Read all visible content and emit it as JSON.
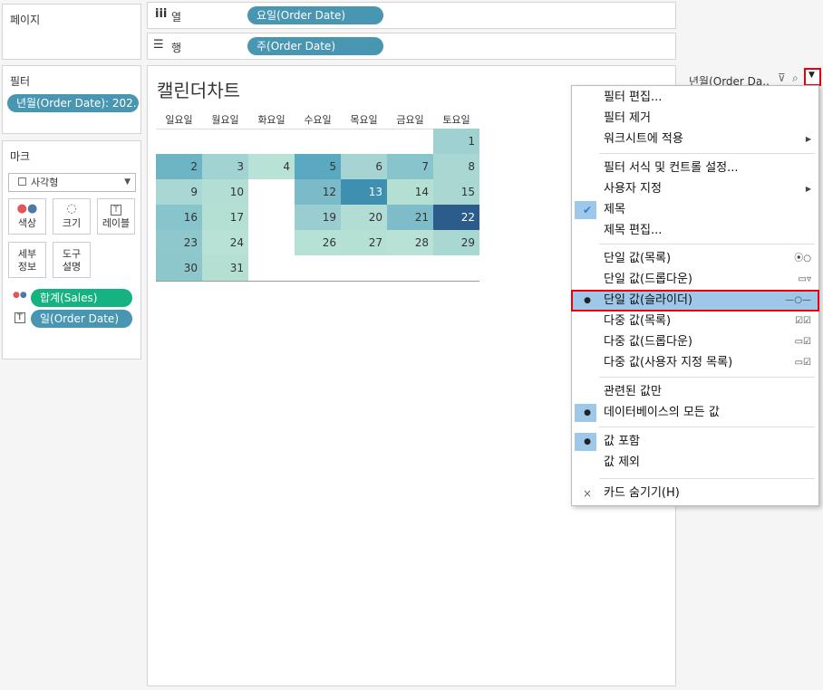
{
  "left": {
    "pages_title": "페이지",
    "filters_title": "필터",
    "filter_pill": "년월(Order Date): 202..",
    "marks_title": "마크",
    "mark_type": "사각형",
    "mark_buttons": [
      {
        "icon": "dots-icon",
        "label": "색상"
      },
      {
        "icon": "size-icon",
        "label": "크기"
      },
      {
        "icon": "text-icon",
        "label": "레이블"
      },
      {
        "icon": "",
        "label": "세부\n정보"
      },
      {
        "icon": "",
        "label": "도구\n설명"
      }
    ],
    "mark_pills": [
      "합계(Sales)",
      "일(Order Date)"
    ]
  },
  "shelves": {
    "columns_label": "열",
    "columns_pill": "요일(Order Date)",
    "rows_label": "행",
    "rows_pill": "주(Order Date)"
  },
  "view": {
    "title": "캘린더차트",
    "weekdays": [
      "일요일",
      "월요일",
      "화요일",
      "수요일",
      "목요일",
      "금요일",
      "토요일"
    ]
  },
  "filter_card": {
    "title": "년월(Order Da.."
  },
  "calendar": [
    {
      "day": "1",
      "col": 6,
      "row": 0,
      "color": "#9fd0d2"
    },
    {
      "day": "2",
      "col": 0,
      "row": 1,
      "color": "#6db4c4"
    },
    {
      "day": "3",
      "col": 1,
      "row": 1,
      "color": "#a1d3d2"
    },
    {
      "day": "4",
      "col": 2,
      "row": 1,
      "color": "#b8e2d5"
    },
    {
      "day": "5",
      "col": 3,
      "row": 1,
      "color": "#5aa9c0"
    },
    {
      "day": "6",
      "col": 4,
      "row": 1,
      "color": "#a6d4d3"
    },
    {
      "day": "7",
      "col": 5,
      "row": 1,
      "color": "#88c4cb"
    },
    {
      "day": "8",
      "col": 6,
      "row": 1,
      "color": "#a9d8d3"
    },
    {
      "day": "9",
      "col": 0,
      "row": 2,
      "color": "#a9d7d3"
    },
    {
      "day": "10",
      "col": 1,
      "row": 2,
      "color": "#b3ded4"
    },
    {
      "day": "12",
      "col": 3,
      "row": 2,
      "color": "#7bbac8"
    },
    {
      "day": "13",
      "col": 4,
      "row": 2,
      "color": "#3e8fb0"
    },
    {
      "day": "14",
      "col": 5,
      "row": 2,
      "color": "#b4e0d4"
    },
    {
      "day": "15",
      "col": 6,
      "row": 2,
      "color": "#a9d8d3"
    },
    {
      "day": "16",
      "col": 0,
      "row": 3,
      "color": "#88c4cb"
    },
    {
      "day": "17",
      "col": 1,
      "row": 3,
      "color": "#b4e0d4"
    },
    {
      "day": "19",
      "col": 3,
      "row": 3,
      "color": "#99cdd0"
    },
    {
      "day": "20",
      "col": 4,
      "row": 3,
      "color": "#b2ddd4"
    },
    {
      "day": "21",
      "col": 5,
      "row": 3,
      "color": "#7dbcc8"
    },
    {
      "day": "22",
      "col": 6,
      "row": 3,
      "color": "#2c5c8c"
    },
    {
      "day": "23",
      "col": 0,
      "row": 4,
      "color": "#8ec8cd"
    },
    {
      "day": "24",
      "col": 1,
      "row": 4,
      "color": "#b8e2d5"
    },
    {
      "day": "26",
      "col": 3,
      "row": 4,
      "color": "#b6e1d5"
    },
    {
      "day": "27",
      "col": 4,
      "row": 4,
      "color": "#b5e0d4"
    },
    {
      "day": "28",
      "col": 5,
      "row": 4,
      "color": "#b7e2d5"
    },
    {
      "day": "29",
      "col": 6,
      "row": 4,
      "color": "#a9d8d3"
    },
    {
      "day": "30",
      "col": 0,
      "row": 5,
      "color": "#8dc7cc"
    },
    {
      "day": "31",
      "col": 1,
      "row": 5,
      "color": "#b4e0d4"
    }
  ],
  "menu": {
    "items": [
      {
        "label": "필터 편집...",
        "left": "",
        "right": ""
      },
      {
        "label": "필터 제거",
        "left": "",
        "right": ""
      },
      {
        "label": "워크시트에 적용",
        "left": "",
        "right": "▶"
      },
      {
        "label": "필터 서식 및 컨트롤 설정...",
        "left": "",
        "right": ""
      },
      {
        "label": "사용자 지정",
        "left": "",
        "right": "▶"
      },
      {
        "label": "제목",
        "left": "✔",
        "right": ""
      },
      {
        "label": "제목 편집...",
        "left": "",
        "right": ""
      },
      {
        "label": "단일 값(목록)",
        "left": "",
        "right": "⦿○"
      },
      {
        "label": "단일 값(드롭다운)",
        "left": "",
        "right": "▭▿"
      },
      {
        "label": "단일 값(슬라이더)",
        "left": "●",
        "right": "—○—"
      },
      {
        "label": "다중 값(목록)",
        "left": "",
        "right": "☑☑"
      },
      {
        "label": "다중 값(드롭다운)",
        "left": "",
        "right": "▭☑"
      },
      {
        "label": "다중 값(사용자 지정 목록)",
        "left": "",
        "right": "▭☑"
      },
      {
        "label": "관련된 값만",
        "left": "",
        "right": ""
      },
      {
        "label": "데이터베이스의 모든 값",
        "left": "●",
        "right": ""
      },
      {
        "label": "값 포함",
        "left": "●",
        "right": ""
      },
      {
        "label": "값 제외",
        "left": "",
        "right": ""
      },
      {
        "label": "카드 숨기기(H)",
        "left": "×",
        "right": ""
      }
    ]
  },
  "colors": {
    "pill_blue": "#4996b2",
    "pill_green": "#15b382",
    "highlight": "#e8000d"
  }
}
